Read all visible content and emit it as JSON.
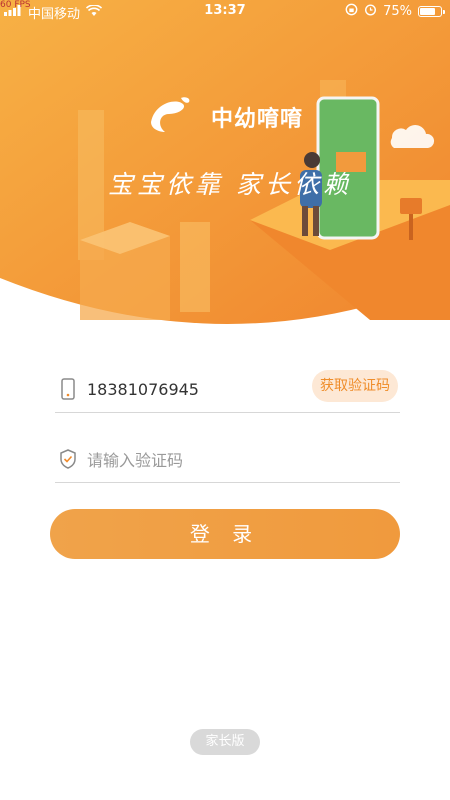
{
  "statusBar": {
    "fps": "60 FPS",
    "carrier": "中国移动",
    "time": "13:37",
    "battery": "75%",
    "battery_level": 0.75
  },
  "hero": {
    "brand": "中幼唷唷",
    "slogan": "宝宝依靠 家长依赖"
  },
  "form": {
    "phone_value": "18381076945",
    "get_code_label": "获取验证码",
    "code_placeholder": "请输入验证码",
    "login_label": "登 录"
  },
  "footer": {
    "version_label": "家长版"
  },
  "colors": {
    "accent": "#f0a040",
    "code_btn_bg": "#fde8d5",
    "code_btn_text": "#ef8d2a"
  }
}
